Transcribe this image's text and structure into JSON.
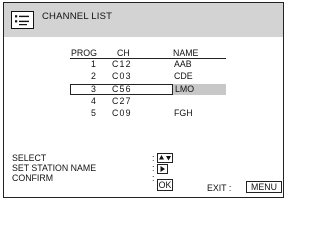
{
  "title": "CHANNEL LIST",
  "columns": {
    "prog": "PROG",
    "ch": "CH",
    "name": "NAME"
  },
  "rows": [
    {
      "prog": "1",
      "ch": "C12",
      "name": "AAB"
    },
    {
      "prog": "2",
      "ch": "C03",
      "name": "CDE"
    },
    {
      "prog": "3",
      "ch": "C56",
      "name": "LMO"
    },
    {
      "prog": "4",
      "ch": "C27",
      "name": ""
    },
    {
      "prog": "5",
      "ch": "C09",
      "name": "FGH"
    }
  ],
  "selected_row": 2,
  "controls": {
    "select_label": "SELECT",
    "set_station_label": "SET STATION NAME",
    "confirm_label": "CONFIRM",
    "colon": ":",
    "ok_label": "OK",
    "select_icon": "up-down-arrows-icon",
    "set_station_icon": "right-arrow-icon"
  },
  "footer": {
    "exit_label": "EXIT",
    "colon": ":",
    "menu_label": "MENU"
  }
}
